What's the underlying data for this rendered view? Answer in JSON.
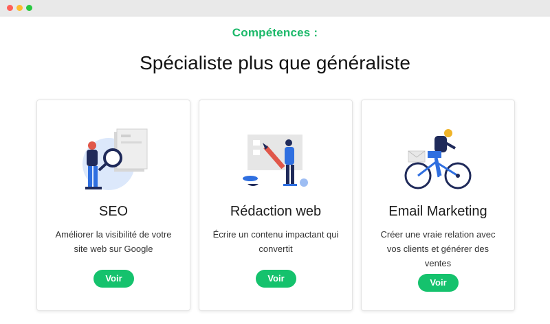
{
  "window": {
    "controls": [
      "close",
      "minimize",
      "maximize"
    ]
  },
  "header": {
    "eyebrow": "Compétences :",
    "title": "Spécialiste plus que généraliste"
  },
  "cards": [
    {
      "illustration": "seo-magnifier-illustration",
      "title": "SEO",
      "description": "Améliorer la visibilité de votre site web sur Google",
      "button": "Voir"
    },
    {
      "illustration": "writing-board-illustration",
      "title": "Rédaction web",
      "description": "Écrire un contenu impactant qui convertit",
      "button": "Voir"
    },
    {
      "illustration": "bike-courier-illustration",
      "title": "Email Marketing",
      "description": "Créer une vraie relation avec vos clients et générer des ventes",
      "button": "Voir"
    }
  ],
  "colors": {
    "accent": "#1db96a",
    "button": "#15c26d",
    "illustration_blue": "#2f6fe0",
    "illustration_navy": "#1f2a5a",
    "illustration_red": "#e0574a"
  }
}
